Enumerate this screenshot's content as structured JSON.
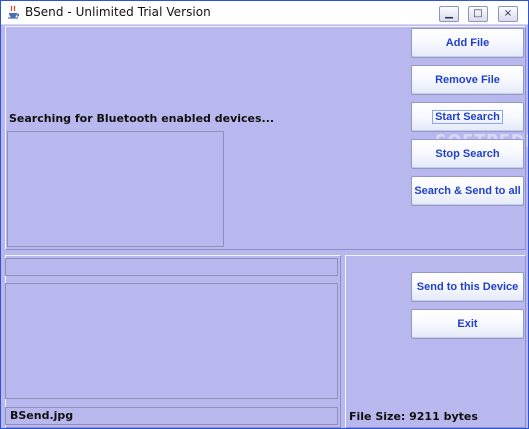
{
  "window": {
    "title": "BSend - Unlimited Trial Version",
    "controls": {
      "minimize_icon": "minimize-icon",
      "maximize_icon": "maximize-icon",
      "close_icon": "close-icon"
    }
  },
  "top_panel": {
    "status_text": "Searching for Bluetooth enabled devices...",
    "buttons": {
      "add_file": "Add File",
      "remove_file": "Remove File",
      "start_search": "Start Search",
      "stop_search": "Stop Search",
      "search_send_all": "Search & Send to all"
    }
  },
  "bottom_panel": {
    "file_name": "BSend.jpg",
    "file_size": "File Size: 9211 bytes",
    "buttons": {
      "send_device": "Send to this Device",
      "exit": "Exit"
    }
  },
  "watermark": {
    "text": "SOFTPEDIA"
  },
  "colors": {
    "accent": "#2140c8",
    "panel_background": "#b8b8ee",
    "title_bar": "#ffffff"
  }
}
